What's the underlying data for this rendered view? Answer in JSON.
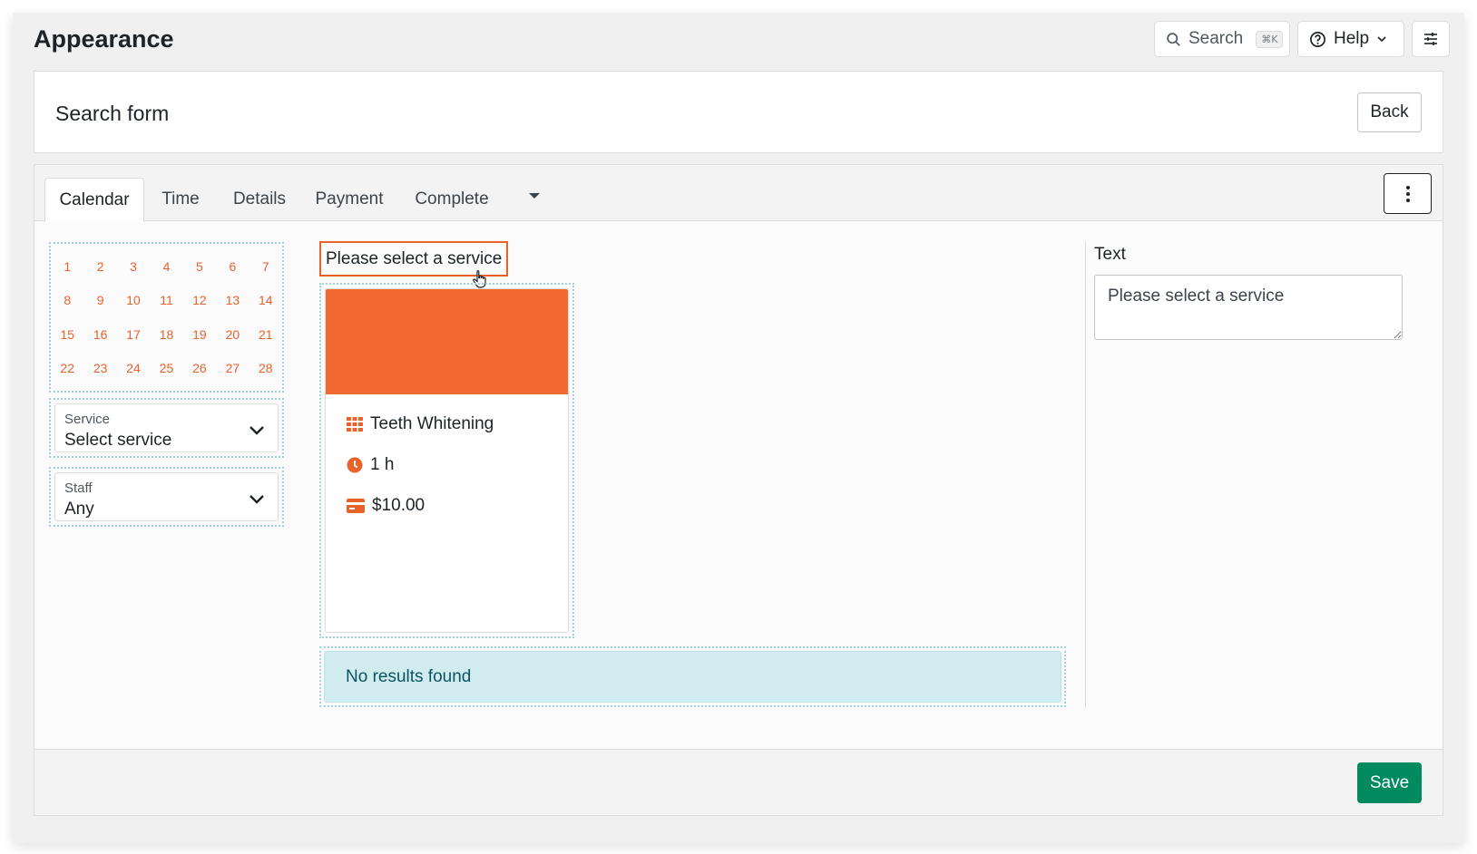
{
  "page": {
    "title": "Appearance"
  },
  "toolbar": {
    "search_label": "Search",
    "search_shortcut": "⌘K",
    "help_label": "Help"
  },
  "header": {
    "title": "Search form",
    "back_label": "Back"
  },
  "tabs": [
    {
      "label": "Calendar",
      "active": true
    },
    {
      "label": "Time"
    },
    {
      "label": "Details"
    },
    {
      "label": "Payment"
    },
    {
      "label": "Complete"
    }
  ],
  "calendar": {
    "days": [
      "1",
      "2",
      "3",
      "4",
      "5",
      "6",
      "7",
      "8",
      "9",
      "10",
      "11",
      "12",
      "13",
      "14",
      "15",
      "16",
      "17",
      "18",
      "19",
      "20",
      "21",
      "22",
      "23",
      "24",
      "25",
      "26",
      "27",
      "28"
    ]
  },
  "filters": {
    "service": {
      "label": "Service",
      "value": "Select service"
    },
    "staff": {
      "label": "Staff",
      "value": "Any"
    }
  },
  "prompt": "Please select a service",
  "service_card": {
    "name": "Teeth Whitening",
    "duration": "1 h",
    "price": "$10.00",
    "banner_color": "#f26a32"
  },
  "no_results": "No results found",
  "sidebar": {
    "text_label": "Text",
    "text_value": "Please select a service"
  },
  "footer": {
    "save_label": "Save"
  },
  "colors": {
    "accent": "#e8622c",
    "save": "#008a5e",
    "info_bg": "#d1ecf1"
  }
}
